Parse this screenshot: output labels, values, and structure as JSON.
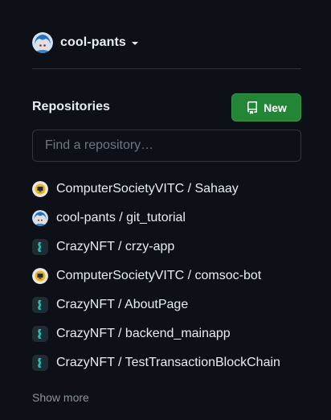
{
  "account": {
    "username": "cool-pants",
    "avatar_icon": "anime-avatar-icon"
  },
  "repositories": {
    "title": "Repositories",
    "new_label": "New",
    "new_icon": "repo-icon",
    "search_placeholder": "Find a repository…",
    "show_more": "Show more",
    "items": [
      {
        "label": "ComputerSocietyVITC / Sahaay",
        "icon": "computer-society-logo-icon"
      },
      {
        "label": "cool-pants / git_tutorial",
        "icon": "anime-avatar-icon"
      },
      {
        "label": "CrazyNFT / crzy-app",
        "icon": "crazynft-logo-icon"
      },
      {
        "label": "ComputerSocietyVITC / comsoc-bot",
        "icon": "computer-society-logo-icon"
      },
      {
        "label": "CrazyNFT / AboutPage",
        "icon": "crazynft-logo-icon"
      },
      {
        "label": "CrazyNFT / backend_mainapp",
        "icon": "crazynft-logo-icon"
      },
      {
        "label": "CrazyNFT / TestTransactionBlockChain",
        "icon": "crazynft-logo-icon"
      }
    ]
  },
  "colors": {
    "background": "#0d1117",
    "border": "#30363d",
    "primary_button": "#238636",
    "text": "#e6edf3",
    "muted_text": "#8b949e"
  }
}
